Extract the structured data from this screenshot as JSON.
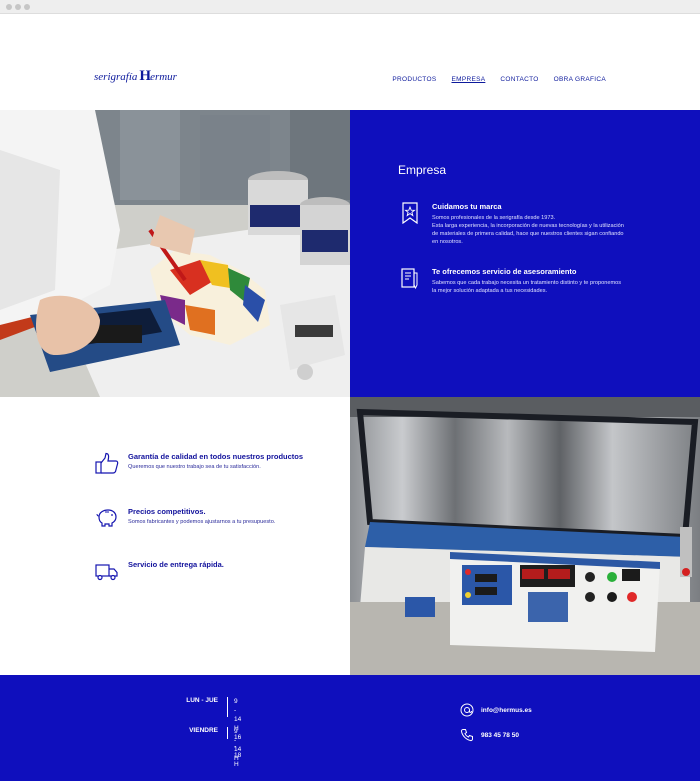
{
  "colors": {
    "brand_blue": "#0f0fbd",
    "dark_blue": "#0d1a9c",
    "white": "#ffffff"
  },
  "header": {
    "logo_prefix": "serigrafía",
    "logo_letter": "H",
    "logo_suffix": "ermur",
    "nav": [
      "PRODUCTOS",
      "EMPRESA",
      "CONTACTO",
      "OBRA GRAFICA"
    ],
    "active_nav": "EMPRESA"
  },
  "empresa": {
    "title": "Empresa",
    "features": [
      {
        "icon": "bookmark-star-icon",
        "title": "Cuidamos tu marca",
        "lines": [
          "Somos profesionales de la serigrafía desde 1973.",
          "Esta larga experiencia, la incorporación de nuevas tecnologías y la utilización",
          "de materiales de primera calidad, hace que nuestros clientes sigan confiando",
          "en nosotros."
        ]
      },
      {
        "icon": "document-pen-icon",
        "title": "Te ofrecemos servicio de asesoramiento",
        "lines": [
          "Sabemos que cada trabajo necesita un tratamiento distinto y te proponemos",
          "la mejor solución adaptada a tus necesidades."
        ]
      }
    ]
  },
  "benefits": [
    {
      "icon": "thumbs-up-icon",
      "title": "Garantía de calidad en todos nuestros productos",
      "text": "Queremos que nuestro trabajo sea de tu satisfacción."
    },
    {
      "icon": "piggy-bank-icon",
      "title": "Precios competitivos.",
      "text": "Somos fabricantes y podemos ajustarnos a tu presupuesto."
    },
    {
      "icon": "delivery-truck-icon",
      "title": "Servicio de entrega rápida.",
      "text": ""
    }
  ],
  "footer": {
    "hours": [
      {
        "day": "LUN - JUE",
        "times": [
          "9 - 14 H",
          "16 - 18 H"
        ]
      },
      {
        "day": "VIENDRE",
        "times": [
          "9 - 14 H"
        ]
      }
    ],
    "email": "info@hermus.es",
    "phone": "983 45 78 50"
  }
}
